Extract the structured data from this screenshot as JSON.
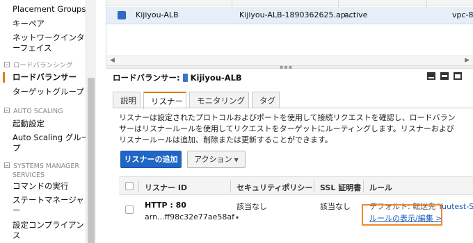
{
  "sidebar": {
    "items": [
      {
        "label": "Placement Groups"
      },
      {
        "label": "キーペア"
      },
      {
        "label_line1": "ネットワークインタ",
        "label_line2": "ーフェイス"
      },
      {
        "section": "ロードバランシング"
      },
      {
        "label": "ロードバランサー",
        "active": true
      },
      {
        "label": "ターゲットグループ"
      },
      {
        "section": "AUTO SCALING"
      },
      {
        "label": "起動設定"
      },
      {
        "label_line1": "Auto Scaling グルー",
        "label_line2": "プ"
      },
      {
        "section_line1": "SYSTEMS MANAGER",
        "section_line2": "SERVICES"
      },
      {
        "label": "コマンドの実行"
      },
      {
        "label_line1": "ステートマネージャ",
        "label_line2": "ー"
      },
      {
        "label_line1": "設定コンプライアン",
        "label_line2": "ス"
      }
    ]
  },
  "top_list": {
    "row": {
      "name": "Kijiyou-ALB",
      "dns": "Kijiyou-ALB-1890362625.ap-...",
      "state": "active",
      "vpc": "vpc-8"
    }
  },
  "detail": {
    "title_prefix": "ロードバランサー:",
    "title_name": "Kijiyou-ALB",
    "tabs": [
      {
        "label": "説明"
      },
      {
        "label": "リスナー",
        "active": true
      },
      {
        "label": "モニタリング"
      },
      {
        "label": "タグ"
      }
    ],
    "description": "リスナーは設定されたプロトコルおよびポートを使用して接続リクエストを確認し、ロードバランサーはリスナールールを使用してリクエストをターゲットにルーティングします。リスナーおよびリスナールールは追加、削除または更新することができます。",
    "add_listener_button": "リスナーの追加",
    "actions_button": "アクション"
  },
  "listener_table": {
    "headers": [
      "リスナー ID",
      "セキュリティポリシー",
      "SSL 証明書",
      "ルール"
    ],
    "rows": [
      {
        "id": "HTTP : 80",
        "arn": "arn...ff98c32e77ae58af",
        "security_policy": "該当なし",
        "ssl_cert": "該当なし",
        "rule_default": "デフォルト: 転送先",
        "rule_target": "Yuutest-S",
        "rule_link": "ルールの表示/編集 >"
      }
    ]
  },
  "colors": {
    "accent": "#e47911",
    "primary_button": "#1f66c6",
    "link": "#1e5fb8",
    "highlight_box": "#f0882a"
  }
}
